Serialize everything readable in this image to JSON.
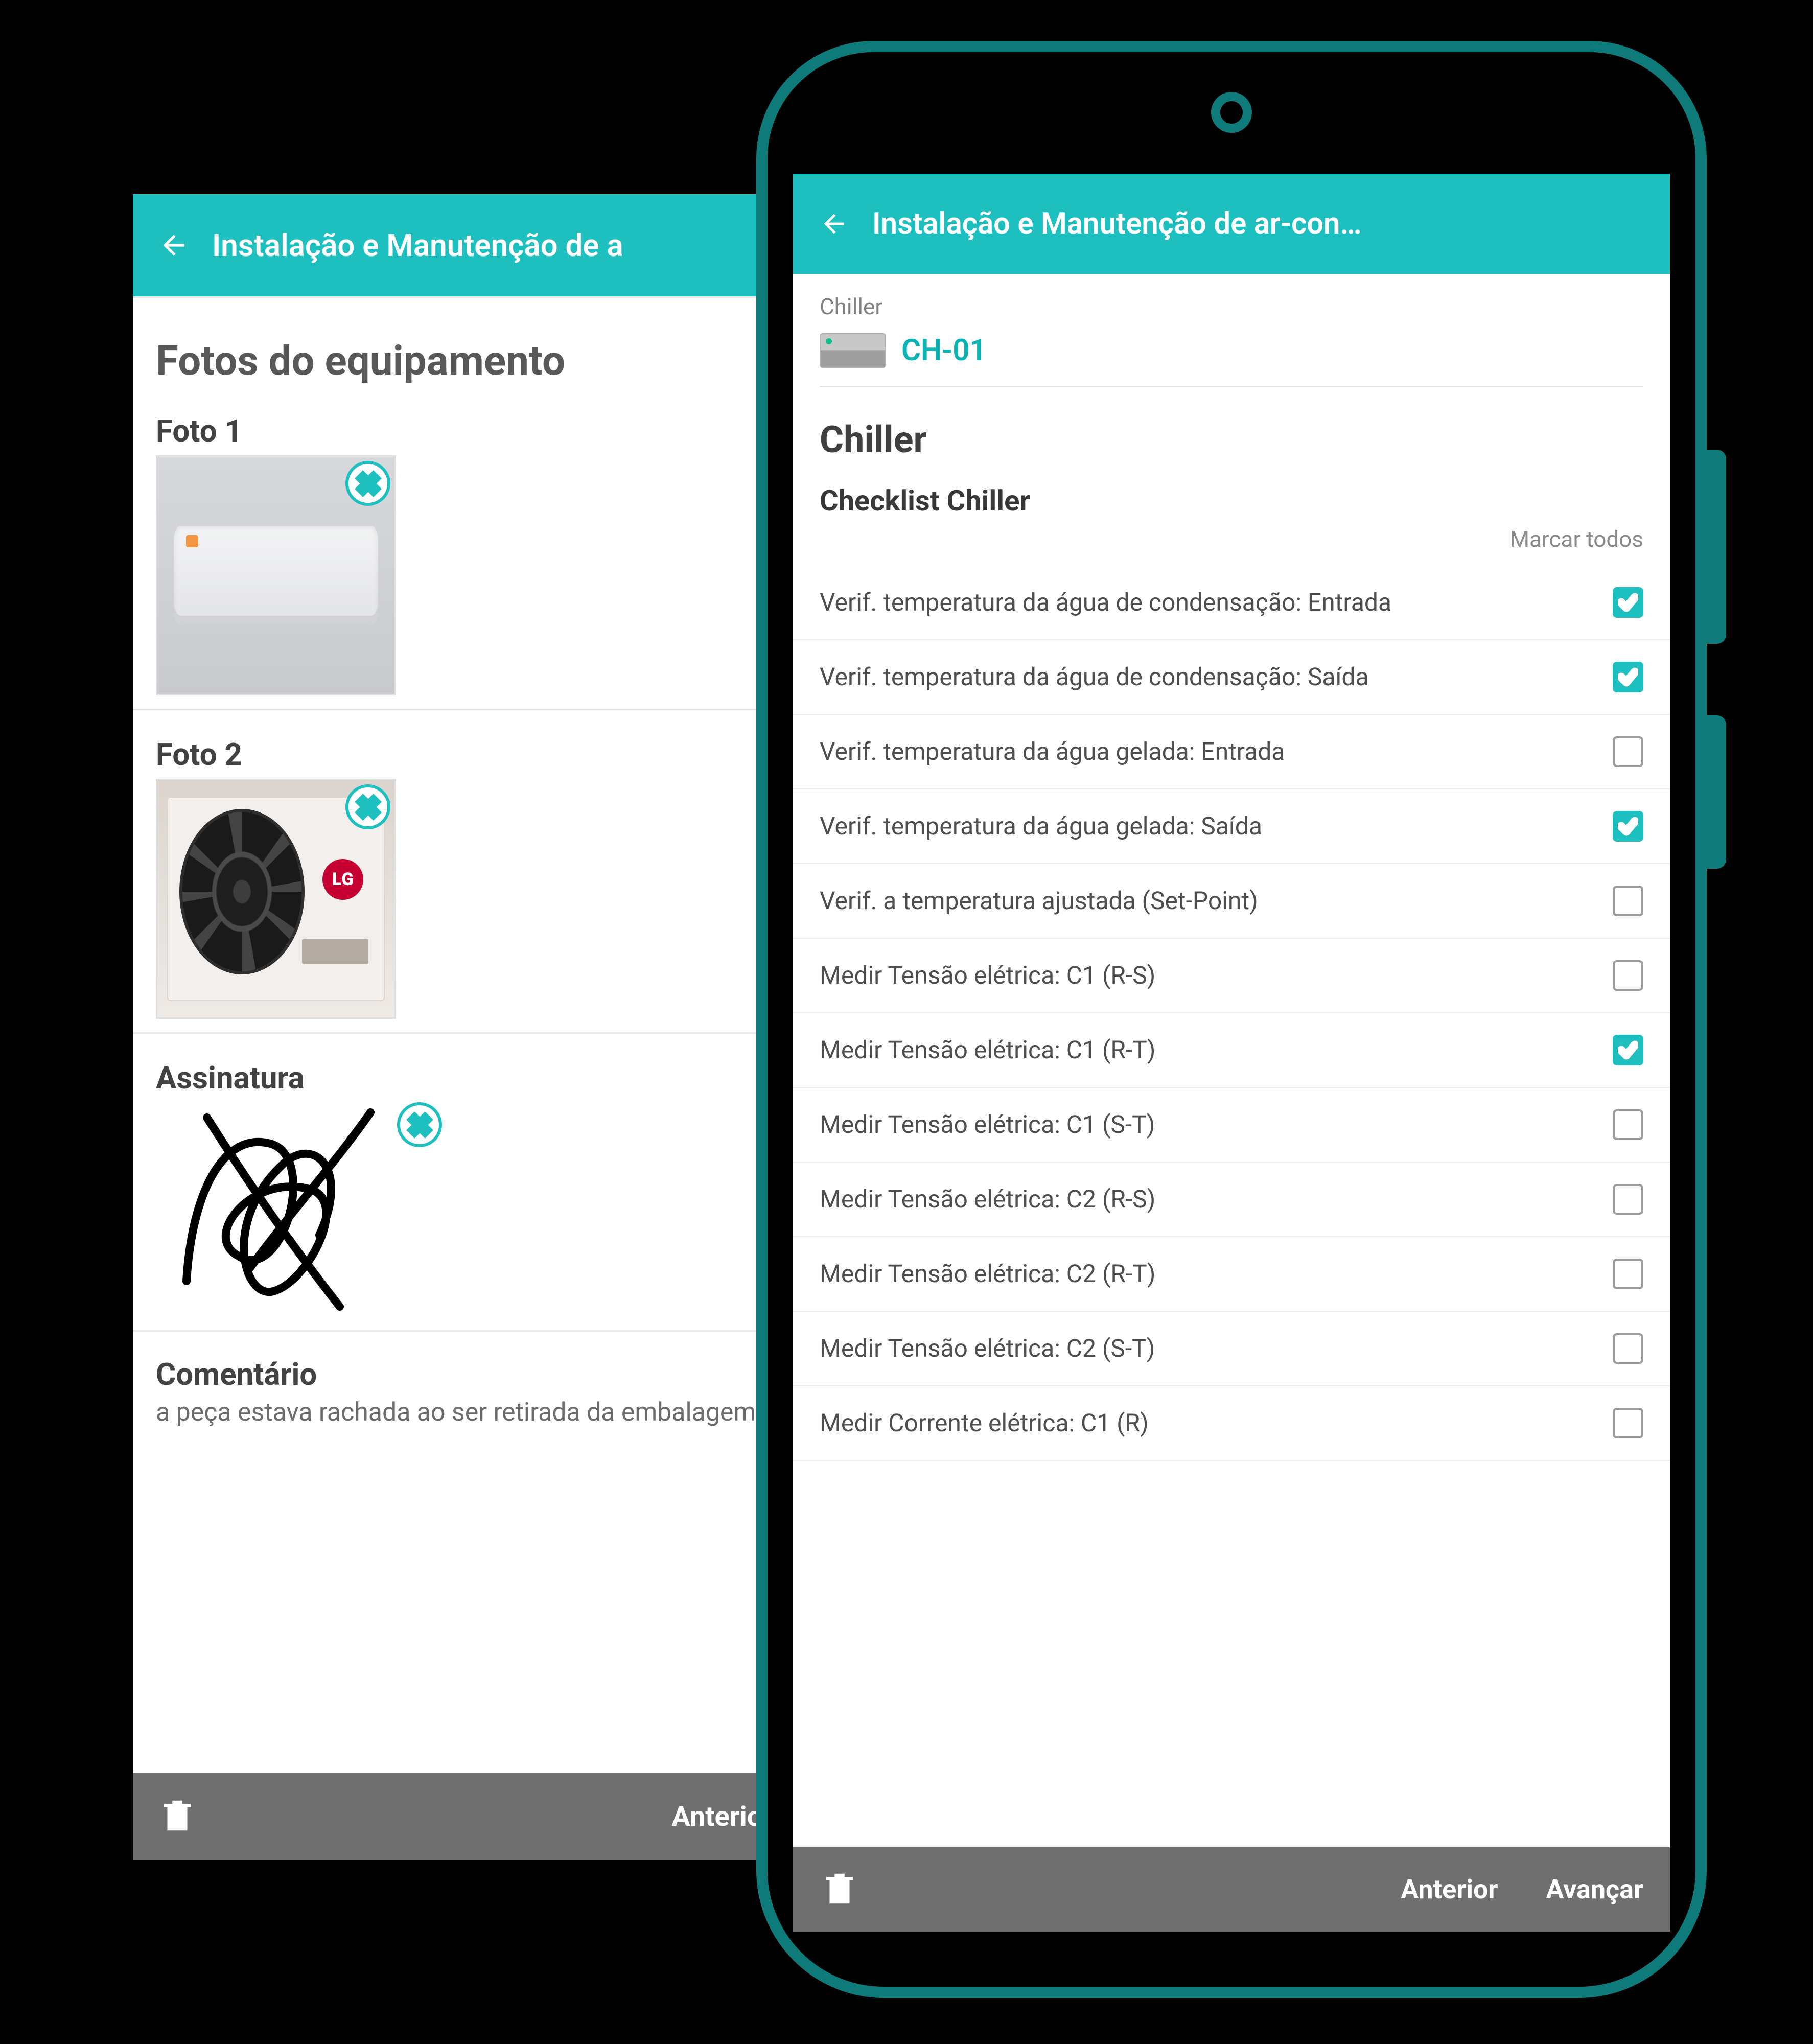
{
  "colors": {
    "accent": "#1DBFBF",
    "frame": "#0E7A7A",
    "footer": "#6f6f6f"
  },
  "back": {
    "header_title": "Instalação e Manutenção de a",
    "section_title": "Fotos do equipamento",
    "photo1_label": "Foto 1",
    "photo2_label": "Foto 2",
    "signature_label": "Assinatura",
    "comment_label": "Comentário",
    "comment_text": "a peça estava rachada ao ser retirada da embalagem",
    "footer_prev": "Anterior",
    "logo_text": "LG"
  },
  "front": {
    "header_title": "Instalação e Manutenção de ar-con…",
    "equipment_type": "Chiller",
    "equipment_id": "CH-01",
    "form_h1": "Chiller",
    "form_h2": "Checklist Chiller",
    "mark_all": "Marcar todos",
    "checklist": [
      {
        "label": "Verif. temperatura da água de condensação: Entrada",
        "checked": true
      },
      {
        "label": "Verif. temperatura da água de condensação: Saída",
        "checked": true
      },
      {
        "label": "Verif. temperatura da água gelada: Entrada",
        "checked": false
      },
      {
        "label": "Verif. temperatura da água gelada: Saída",
        "checked": true
      },
      {
        "label": "Verif. a temperatura ajustada (Set-Point)",
        "checked": false
      },
      {
        "label": "Medir Tensão elétrica: C1 (R-S)",
        "checked": false
      },
      {
        "label": "Medir Tensão elétrica: C1 (R-T)",
        "checked": true
      },
      {
        "label": "Medir Tensão elétrica: C1 (S-T)",
        "checked": false
      },
      {
        "label": "Medir Tensão elétrica: C2 (R-S)",
        "checked": false
      },
      {
        "label": "Medir Tensão elétrica: C2 (R-T)",
        "checked": false
      },
      {
        "label": "Medir Tensão elétrica: C2 (S-T)",
        "checked": false
      },
      {
        "label": "Medir Corrente elétrica: C1 (R)",
        "checked": false
      }
    ],
    "footer_prev": "Anterior",
    "footer_next": "Avançar"
  }
}
